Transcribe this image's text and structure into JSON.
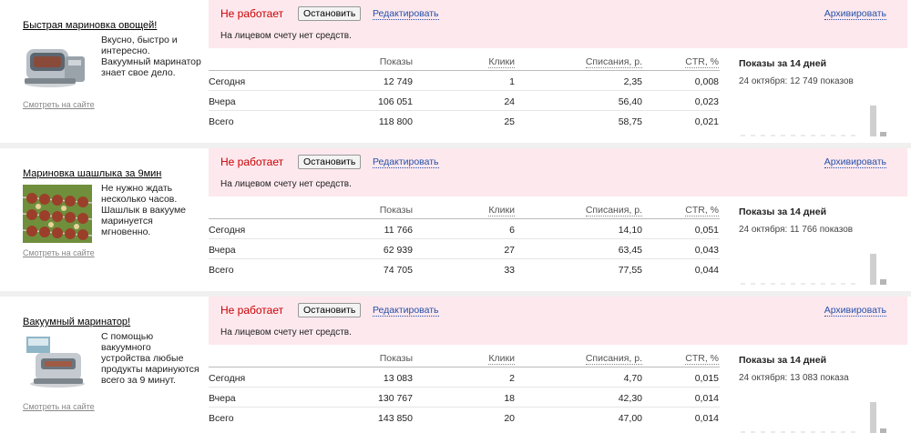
{
  "common": {
    "status": "Не работает",
    "stop_label": "Остановить",
    "edit_label": "Редактировать",
    "archive_label": "Архивировать",
    "no_funds": "На лицевом счету нет средств.",
    "site_link": "Смотреть на сайте",
    "headers": {
      "shows": "Показы",
      "clicks": "Клики",
      "spend": "Списания, р.",
      "ctr": "CTR, %"
    },
    "side_title": "Показы за 14 дней"
  },
  "ads": [
    {
      "title": "Быстрая маринoвка овощей!",
      "text": "Вкусно, быстро и интересно. Вакуумный маринатор знает свое дело.",
      "image_icon": "vacuum-marinator-image",
      "side_sub": "24 октября: 12 749 показов",
      "rows": [
        {
          "label": "Сегодня",
          "shows": "12 749",
          "clicks": "1",
          "spend": "2,35",
          "ctr": "0,008"
        },
        {
          "label": "Вчера",
          "shows": "106 051",
          "clicks": "24",
          "spend": "56,40",
          "ctr": "0,023"
        },
        {
          "label": "Всего",
          "shows": "118 800",
          "clicks": "25",
          "spend": "58,75",
          "ctr": "0,021"
        }
      ]
    },
    {
      "title": "Маринoвка шашлыка за 9мин",
      "text": "Не нужно ждать несколько часов. Шашлык в вакууме маринуется мгновенно.",
      "image_icon": "shashlik-image",
      "side_sub": "24 октября: 11 766 показов",
      "rows": [
        {
          "label": "Сегодня",
          "shows": "11 766",
          "clicks": "6",
          "spend": "14,10",
          "ctr": "0,051"
        },
        {
          "label": "Вчера",
          "shows": "62 939",
          "clicks": "27",
          "spend": "63,45",
          "ctr": "0,043"
        },
        {
          "label": "Всего",
          "shows": "74 705",
          "clicks": "33",
          "spend": "77,55",
          "ctr": "0,044"
        }
      ]
    },
    {
      "title": "Вакуумный маринатор!",
      "text": "С помощью вакуумного устройства любые продукты маринуются всего за 9 минут.",
      "image_icon": "vacuum-device-image",
      "side_sub": "24 октября: 13 083 показа",
      "rows": [
        {
          "label": "Сегодня",
          "shows": "13 083",
          "clicks": "2",
          "spend": "4,70",
          "ctr": "0,015"
        },
        {
          "label": "Вчера",
          "shows": "130 767",
          "clicks": "18",
          "spend": "42,30",
          "ctr": "0,014"
        },
        {
          "label": "Всего",
          "shows": "143 850",
          "clicks": "20",
          "spend": "47,00",
          "ctr": "0,014"
        }
      ]
    }
  ],
  "colors": {
    "status_bg": "#fde8ee",
    "status_text": "#cc0000",
    "link": "#2550a8",
    "separator": "#f0f0f0"
  }
}
